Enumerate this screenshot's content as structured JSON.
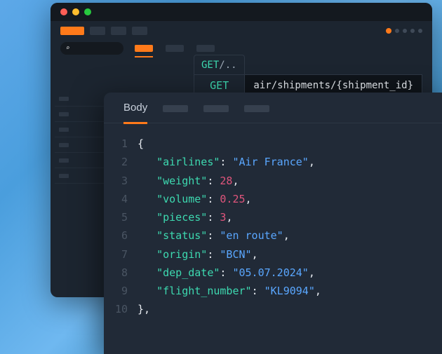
{
  "colors": {
    "accent": "#ff7a1a",
    "method": "#3dd9b0",
    "string": "#5aa7ff",
    "number": "#e0557c"
  },
  "method_tab": {
    "method": "GET",
    "suffix": "/.."
  },
  "request": {
    "method": "GET",
    "url": "air/shipments/{shipment_id}"
  },
  "response": {
    "active_tab": "Body",
    "body": {
      "airlines": "Air France",
      "weight": 28,
      "volume": 0.25,
      "pieces": 3,
      "status": "en route",
      "origin": "BCN",
      "dep_date": "05.07.2024",
      "flight_number": "KL9094"
    }
  }
}
